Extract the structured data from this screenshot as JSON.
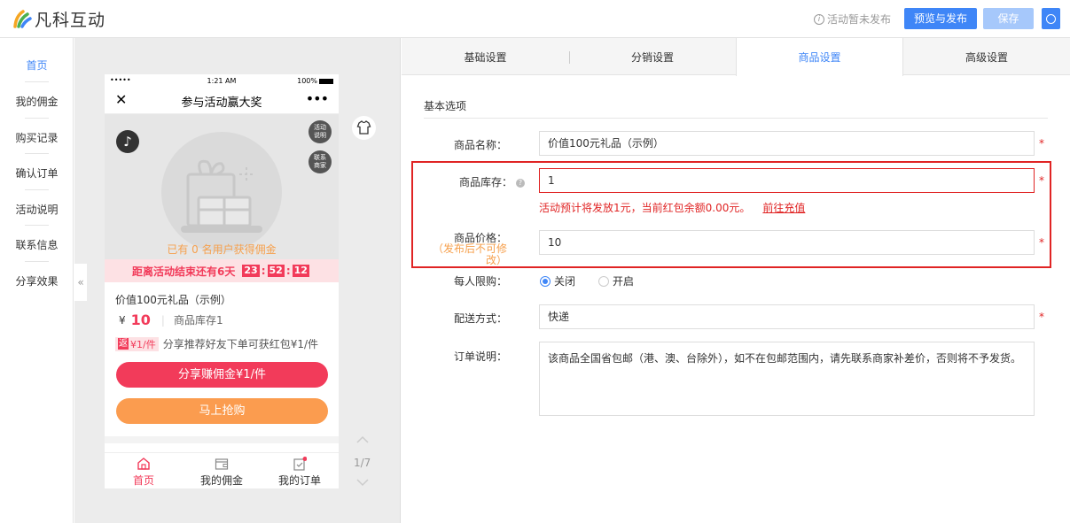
{
  "app": {
    "logo_text": "凡科互动",
    "status_text": "活动暂未发布",
    "publish_label": "预览与发布",
    "save_label": "保存"
  },
  "leftnav": {
    "items": [
      "首页",
      "我的佣金",
      "购买记录",
      "确认订单",
      "活动说明",
      "联系信息",
      "分享效果"
    ],
    "collapse_icon": "«"
  },
  "phone": {
    "status": {
      "signal": "•••••",
      "time": "1:21 AM",
      "battery": "100%"
    },
    "title": "参与活动赢大奖",
    "close": "✕",
    "more": "•••",
    "side_buttons": [
      "活动说明",
      "联系商家"
    ],
    "earned_text": "已有 0 名用户获得佣金",
    "countdown": {
      "label": "距离活动结束还有6天",
      "h": "23",
      "m": "52",
      "s": "12",
      "sep": ":"
    },
    "product_name": "价值100元礼品（示例）",
    "currency": "¥",
    "price": "10",
    "separator": "|",
    "stock_text": "商品库存1",
    "rebate": {
      "icon_text": "返",
      "amount": "¥1/件",
      "desc": "分享推荐好友下单可获红包¥1/件"
    },
    "share_button": "分享赚佣金¥1/件",
    "buy_button": "马上抢购",
    "tabs": [
      "首页",
      "我的佣金",
      "我的订单"
    ]
  },
  "pager": {
    "text": "1/7"
  },
  "settings": {
    "tabs": [
      "基础设置",
      "分销设置",
      "商品设置",
      "高级设置"
    ],
    "active_tab": 2,
    "section_title": "基本选项",
    "fields": {
      "name": {
        "label": "商品名称：",
        "value": "价值100元礼品（示例）"
      },
      "stock": {
        "label": "商品库存：",
        "value": "1",
        "help_icon": "?"
      },
      "stock_error": "活动预计将发放1元，当前红包余额0.00元。",
      "recharge_link": "前往充值",
      "price": {
        "label": "商品价格：",
        "note": "（发布后不可修改）",
        "value": "10"
      },
      "limit": {
        "label": "每人限购：",
        "options": [
          "关闭",
          "开启"
        ],
        "selected": "关闭"
      },
      "delivery": {
        "label": "配送方式：",
        "value": "快递"
      },
      "order_note": {
        "label": "订单说明：",
        "value": "该商品全国省包邮（港、澳、台除外），如不在包邮范围内，请先联系商家补差价，否则将不予发货。"
      }
    },
    "required_mark": "*"
  },
  "colors": {
    "primary": "#3f86f7",
    "danger": "#e02424",
    "pink": "#f23b5a",
    "orange": "#fb9c4f"
  }
}
